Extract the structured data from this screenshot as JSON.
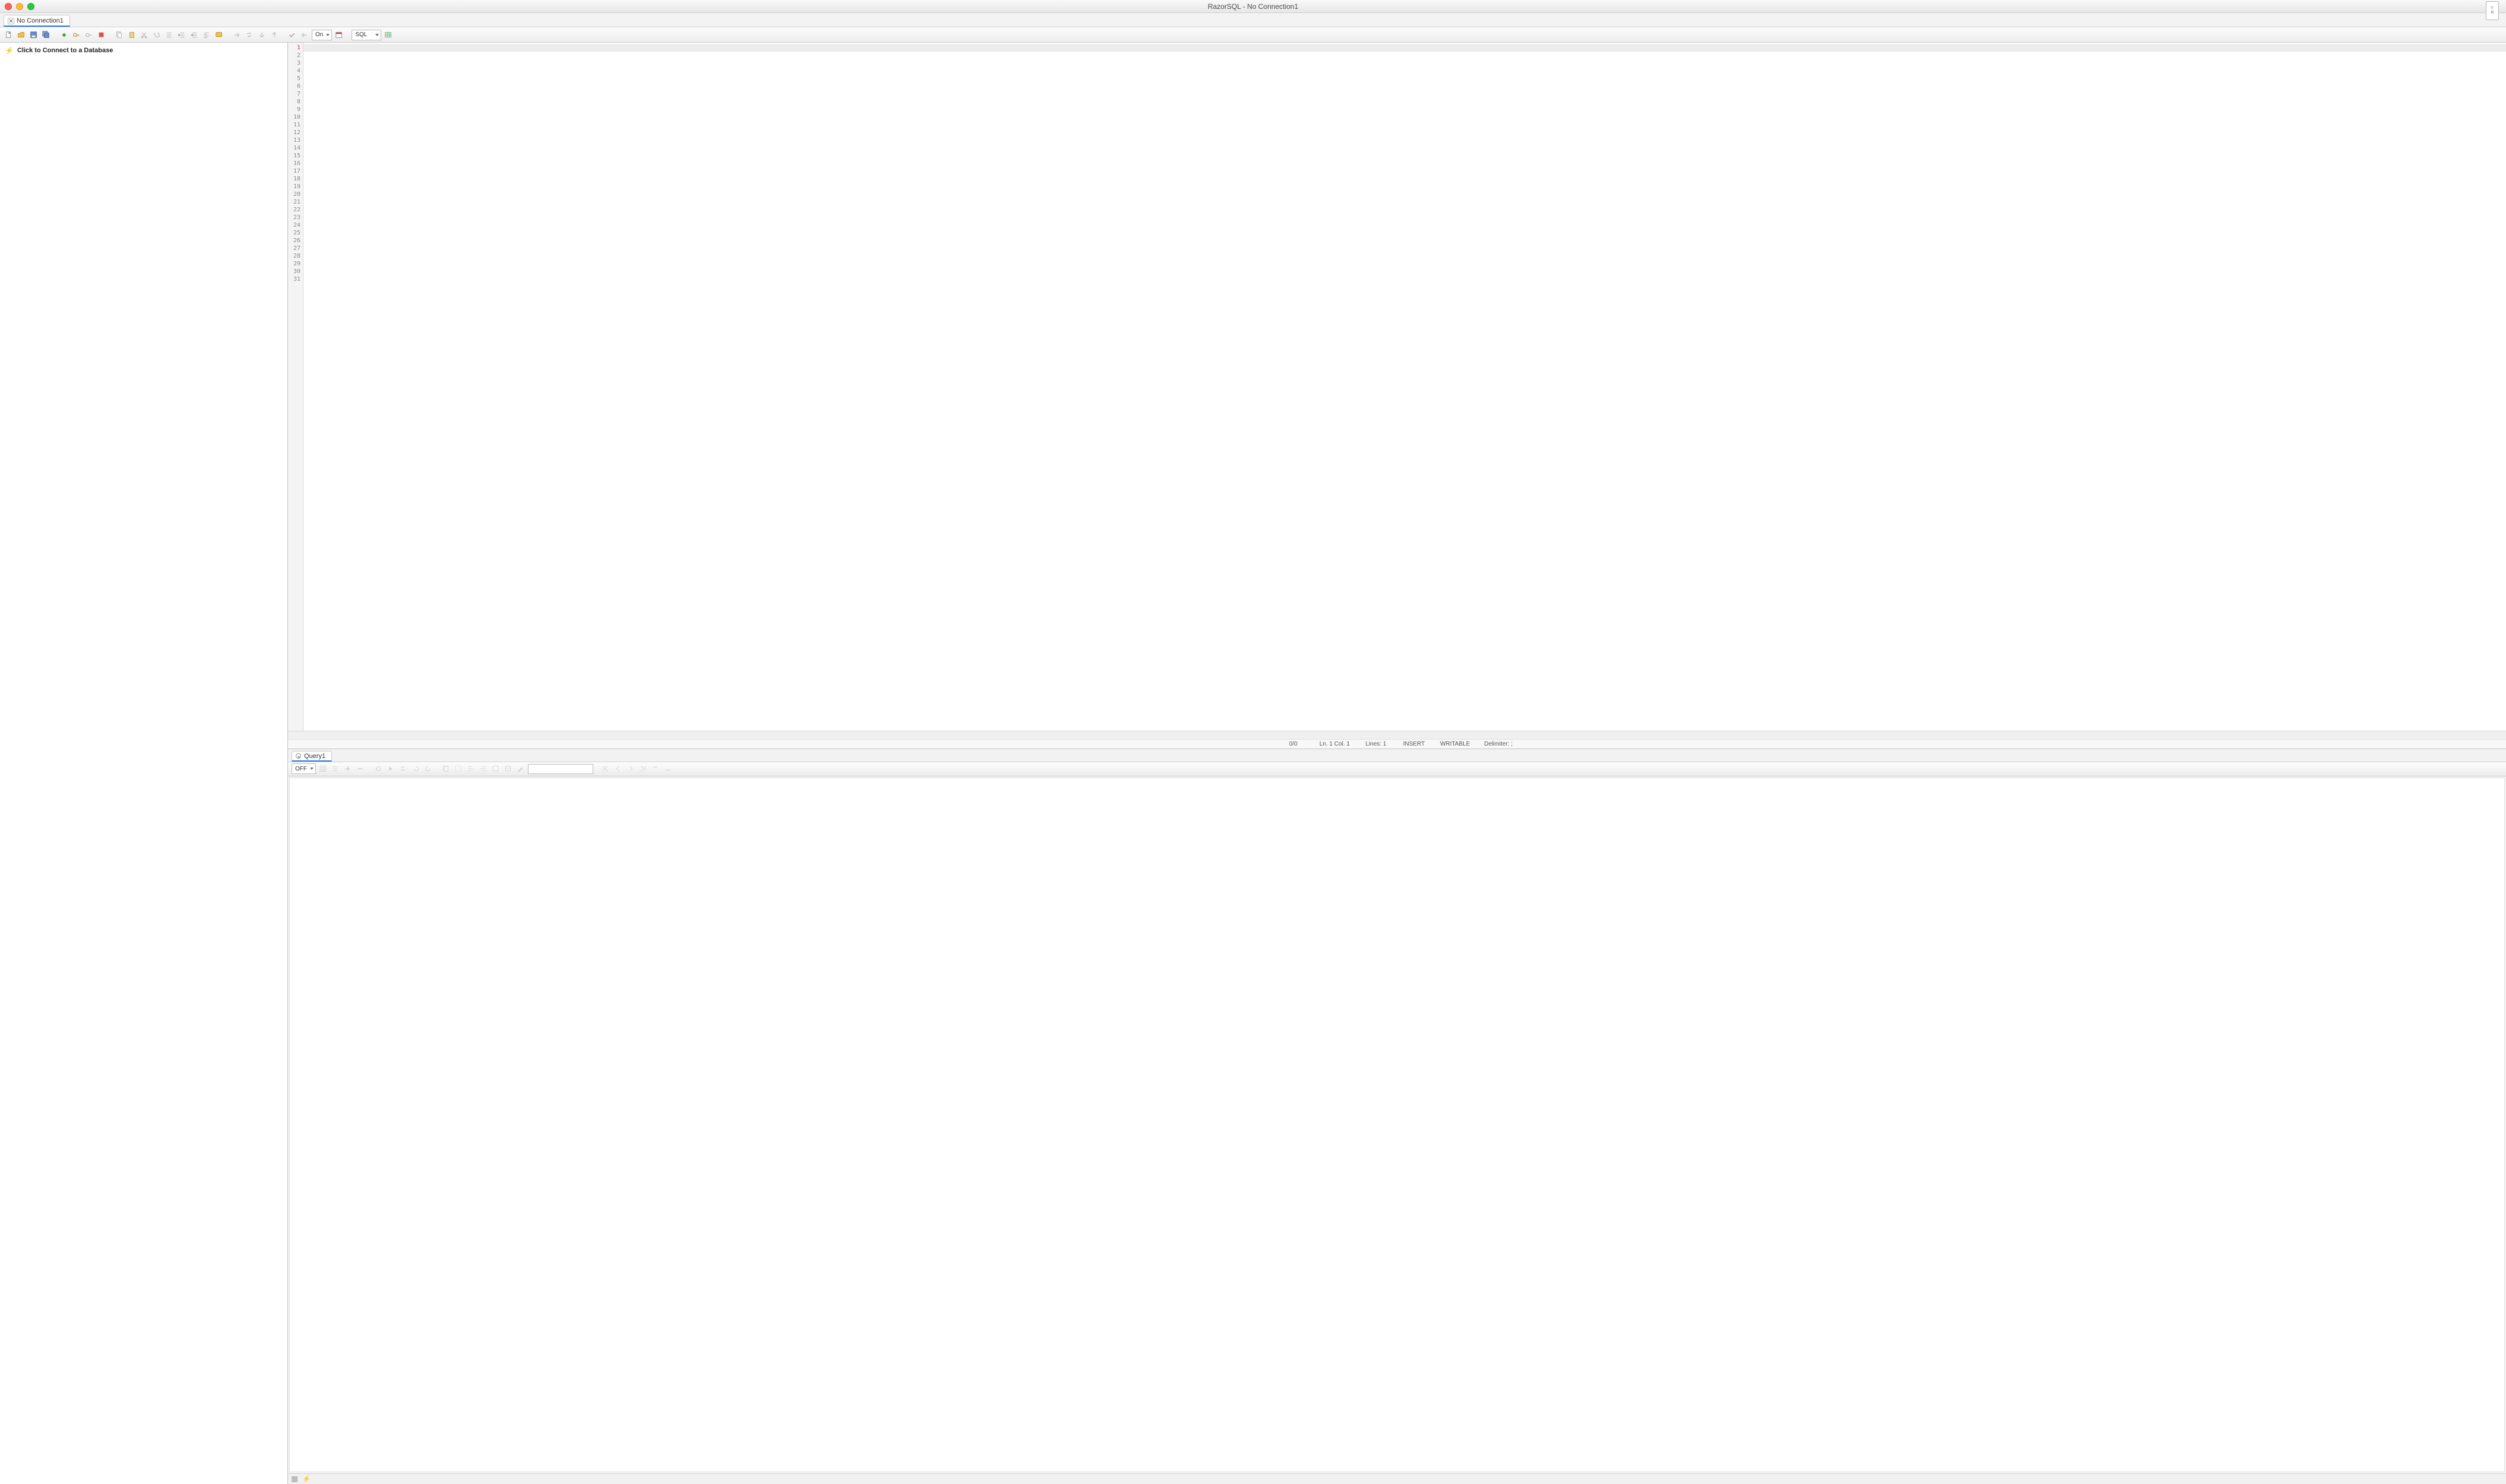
{
  "window": {
    "title": "RazorSQL - No Connection1"
  },
  "connTab": {
    "label": "No Connection1"
  },
  "sidebar": {
    "connectPrompt": "Click to Connect to a Database"
  },
  "mainToolbar": {
    "onLabel": "On",
    "langLabel": "SQL"
  },
  "editor": {
    "lineCount": 31
  },
  "status": {
    "pos": "0/0",
    "lncol": "Ln. 1 Col. 1",
    "lines": "Lines: 1",
    "mode": "INSERT",
    "rw": "WRITABLE",
    "delim": "Delimiter: ;"
  },
  "queryTab": {
    "label": "Query1"
  },
  "resultsToolbar": {
    "offLabel": "OFF"
  }
}
